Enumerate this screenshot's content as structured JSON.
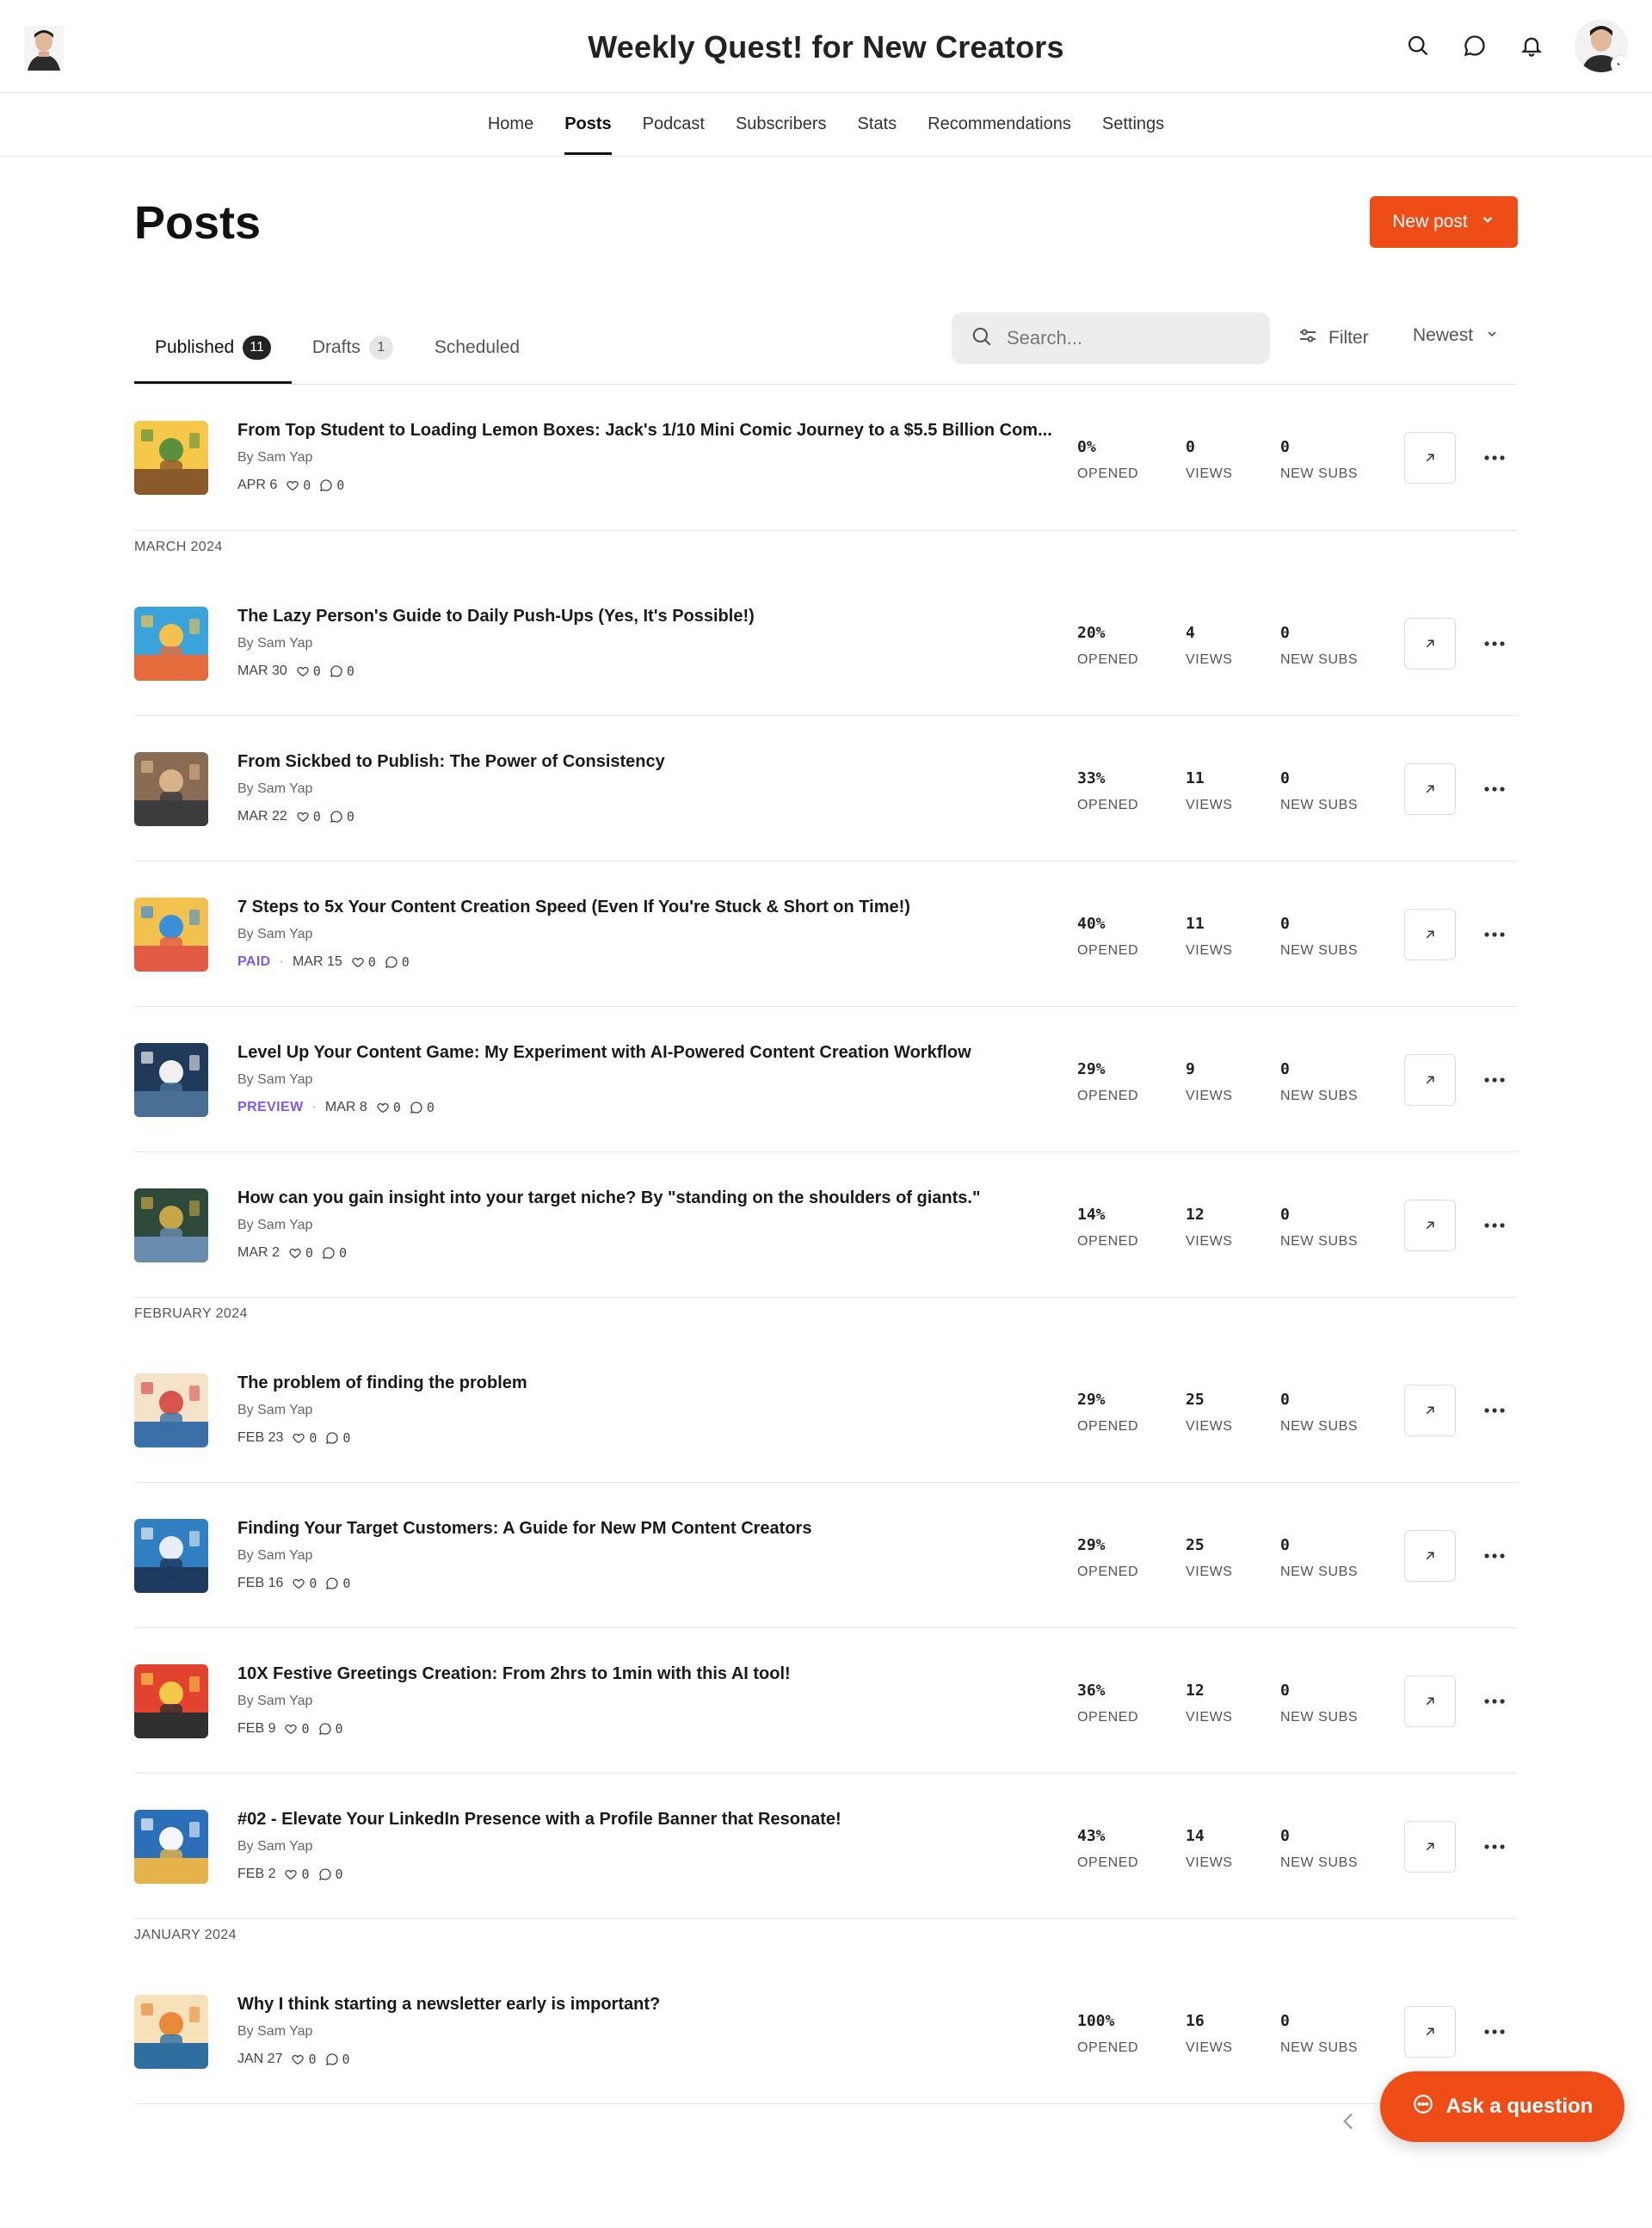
{
  "header": {
    "site_title": "Weekly Quest! for New Creators"
  },
  "nav": [
    "Home",
    "Posts",
    "Podcast",
    "Subscribers",
    "Stats",
    "Recommendations",
    "Settings"
  ],
  "page": {
    "title": "Posts",
    "new_post_label": "New post"
  },
  "tabs": [
    {
      "label": "Published",
      "count": "11"
    },
    {
      "label": "Drafts",
      "count": "1"
    },
    {
      "label": "Scheduled",
      "count": ""
    }
  ],
  "search": {
    "placeholder": "Search..."
  },
  "filter_label": "Filter",
  "sort_label": "Newest",
  "stat_labels": {
    "opened": "OPENED",
    "views": "VIEWS",
    "subs": "NEW SUBS"
  },
  "months": [
    "MARCH 2024",
    "FEBRUARY 2024",
    "JANUARY 2024"
  ],
  "posts": [
    {
      "title": "From Top Student to Loading Lemon Boxes: Jack's 1/10 Mini Comic Journey to a $5.5 Billion Com...",
      "author": "By Sam Yap",
      "tag": "",
      "date": "APR 6",
      "likes": "0",
      "comments": "0",
      "opened": "0%",
      "views": "0",
      "subs": "0"
    },
    {
      "title": "The Lazy Person's Guide to Daily Push-Ups (Yes, It's Possible!)",
      "author": "By Sam Yap",
      "tag": "",
      "date": "MAR 30",
      "likes": "0",
      "comments": "0",
      "opened": "20%",
      "views": "4",
      "subs": "0"
    },
    {
      "title": "From Sickbed to Publish: The Power of Consistency",
      "author": "By Sam Yap",
      "tag": "",
      "date": "MAR 22",
      "likes": "0",
      "comments": "0",
      "opened": "33%",
      "views": "11",
      "subs": "0"
    },
    {
      "title": "7 Steps to 5x Your Content Creation Speed (Even If You're Stuck & Short on Time!)",
      "author": "By Sam Yap",
      "tag": "PAID",
      "date": "MAR 15",
      "likes": "0",
      "comments": "0",
      "opened": "40%",
      "views": "11",
      "subs": "0"
    },
    {
      "title": "Level Up Your Content Game: My Experiment with AI-Powered Content Creation Workflow",
      "author": "By Sam Yap",
      "tag": "PREVIEW",
      "date": "MAR 8",
      "likes": "0",
      "comments": "0",
      "opened": "29%",
      "views": "9",
      "subs": "0"
    },
    {
      "title": "How can you gain insight into your target niche? By \"standing on the shoulders of giants.\"",
      "author": "By Sam Yap",
      "tag": "",
      "date": "MAR 2",
      "likes": "0",
      "comments": "0",
      "opened": "14%",
      "views": "12",
      "subs": "0"
    },
    {
      "title": "The problem of finding the problem",
      "author": "By Sam Yap",
      "tag": "",
      "date": "FEB 23",
      "likes": "0",
      "comments": "0",
      "opened": "29%",
      "views": "25",
      "subs": "0"
    },
    {
      "title": "Finding Your Target Customers: A Guide for New PM Content Creators",
      "author": "By Sam Yap",
      "tag": "",
      "date": "FEB 16",
      "likes": "0",
      "comments": "0",
      "opened": "29%",
      "views": "25",
      "subs": "0"
    },
    {
      "title": "10X Festive Greetings Creation: From 2hrs to 1min with this AI tool!",
      "author": "By Sam Yap",
      "tag": "",
      "date": "FEB 9",
      "likes": "0",
      "comments": "0",
      "opened": "36%",
      "views": "12",
      "subs": "0"
    },
    {
      "title": "#02 - Elevate Your LinkedIn Presence with a Profile Banner that Resonate!",
      "author": "By Sam Yap",
      "tag": "",
      "date": "FEB 2",
      "likes": "0",
      "comments": "0",
      "opened": "43%",
      "views": "14",
      "subs": "0"
    },
    {
      "title": "Why I think starting a newsletter early is important?",
      "author": "By Sam Yap",
      "tag": "",
      "date": "JAN 27",
      "likes": "0",
      "comments": "0",
      "opened": "100%",
      "views": "16",
      "subs": "0"
    }
  ],
  "ask_label": "Ask a question",
  "colors": {
    "accent": "#ee4d18",
    "tag": "#7a5af8",
    "divider": "#e6e6e6"
  }
}
